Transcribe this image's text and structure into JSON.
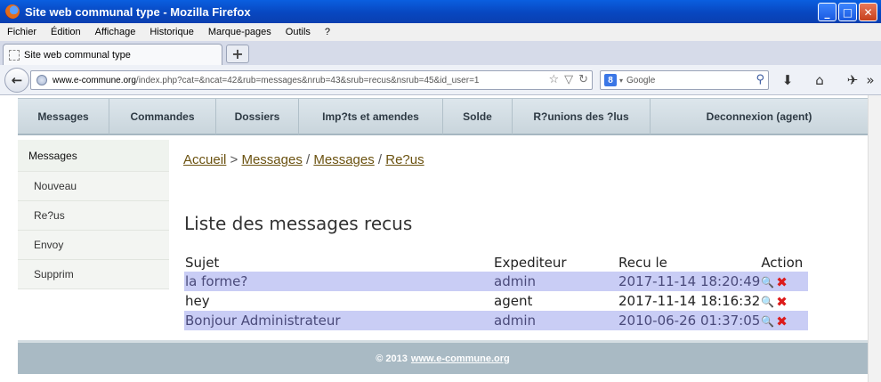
{
  "window": {
    "title": "Site web communal type - Mozilla Firefox"
  },
  "menu": [
    "Fichier",
    "Édition",
    "Affichage",
    "Historique",
    "Marque-pages",
    "Outils",
    "?"
  ],
  "tab": {
    "title": "Site web communal type"
  },
  "address": {
    "host": "www.e-commune.org",
    "path": "/index.php?cat=&ncat=42&rub=messages&nrub=43&srub=recus&nsrub=45&id_user=1"
  },
  "search": {
    "placeholder": "Google"
  },
  "topnav": [
    {
      "label": "Messages",
      "width": 103
    },
    {
      "label": "Commandes",
      "width": 120
    },
    {
      "label": "Dossiers",
      "width": 93
    },
    {
      "label": "Imp?ts et amendes",
      "width": 162
    },
    {
      "label": "Solde",
      "width": 78
    },
    {
      "label": "R?unions des ?lus",
      "width": 155
    },
    {
      "label": "Deconnexion (agent)",
      "width": 244
    }
  ],
  "leftmenu": {
    "heading": "Messages",
    "items": [
      "Nouveau",
      "Re?us",
      "Envoy",
      "Supprim"
    ]
  },
  "breadcrumb": {
    "home": "Accueil",
    "sep1": ">",
    "level1": "Messages",
    "sep2": "/",
    "level2": "Messages",
    "sep3": "/",
    "level3": "Re?us"
  },
  "page_title": "Liste des messages recus",
  "table": {
    "headers": {
      "subject": "Sujet",
      "sender": "Expediteur",
      "received": "Recu le",
      "action": "Action"
    },
    "rows": [
      {
        "subject": "la forme?",
        "sender": "admin",
        "received": "2017-11-14 18:20:49"
      },
      {
        "subject": "hey",
        "sender": "agent",
        "received": "2017-11-14 18:16:32"
      },
      {
        "subject": "Bonjour Administrateur",
        "sender": "admin",
        "received": "2010-06-26 01:37:05"
      }
    ]
  },
  "footer": {
    "prefix": "© 2013",
    "link": "www.e-commune.org"
  }
}
